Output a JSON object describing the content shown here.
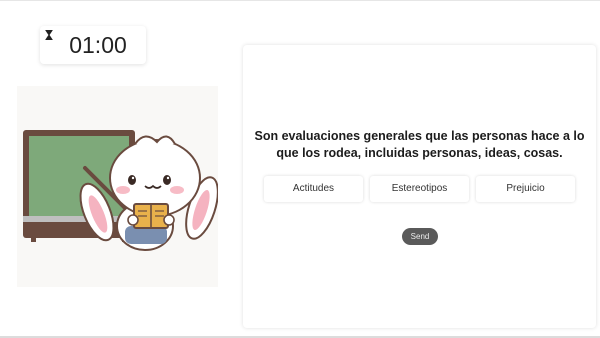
{
  "timer": {
    "icon": "hourglass-icon",
    "time": "01:00"
  },
  "illustration": {
    "subject": "bunny-teacher-with-chalkboard"
  },
  "quiz": {
    "question_line1": "Son evaluaciones generales que las personas hace a lo",
    "question_line2": "que los rodea, incluidas personas, ideas, cosas.",
    "options": [
      "Actitudes",
      "Estereotipos",
      "Prejuicio"
    ],
    "send_label": "Send"
  },
  "colors": {
    "send_button": "#5a5a5a",
    "chalkboard": "#7ea97a",
    "chalkboard_frame": "#6a4b3f"
  }
}
